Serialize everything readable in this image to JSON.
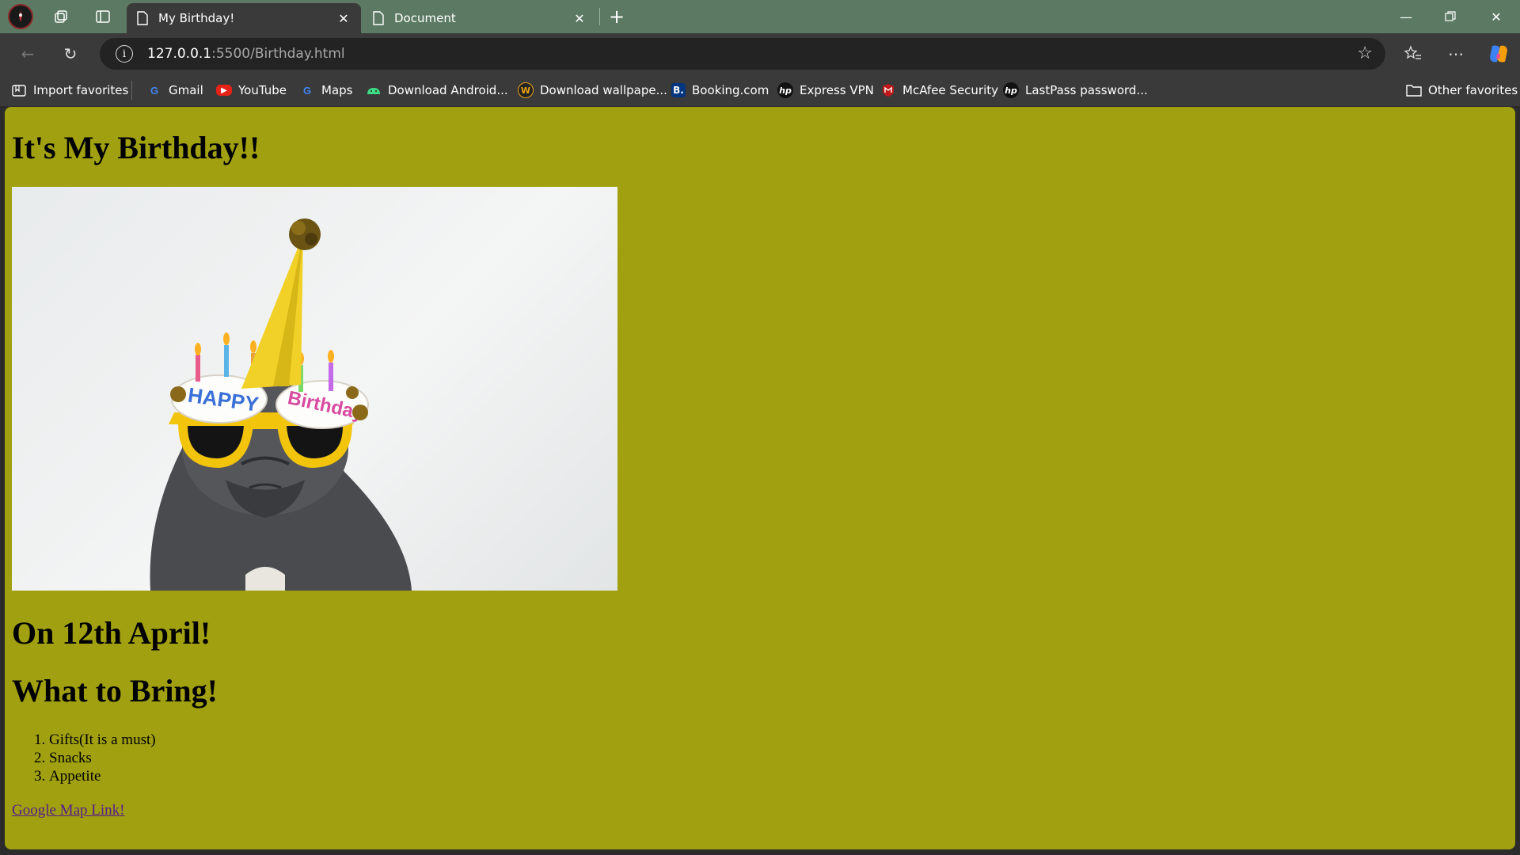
{
  "browser": {
    "tabs": [
      {
        "title": "My Birthday!",
        "active": true
      },
      {
        "title": "Document",
        "active": false
      }
    ],
    "address": {
      "host": "127.0.0.1",
      "rest": ":5500/Birthday.html"
    },
    "bookmarks": [
      {
        "label": "Import favorites",
        "icon": "import-icon"
      },
      {
        "label": "Gmail",
        "icon": "google-icon"
      },
      {
        "label": "YouTube",
        "icon": "youtube-icon"
      },
      {
        "label": "Maps",
        "icon": "google-icon"
      },
      {
        "label": "Download Android...",
        "icon": "android-icon"
      },
      {
        "label": "Download wallpape...",
        "icon": "wallpaper-icon"
      },
      {
        "label": "Booking.com",
        "icon": "booking-icon"
      },
      {
        "label": "Express VPN",
        "icon": "hp-icon"
      },
      {
        "label": "McAfee Security",
        "icon": "mcafee-icon"
      },
      {
        "label": "LastPass password...",
        "icon": "hp-icon"
      }
    ],
    "other_favorites": "Other favorites",
    "colors": {
      "tabstrip": "#5c7a63",
      "toolbar": "#3a3a3a",
      "page_bg": "#a0a010"
    }
  },
  "page": {
    "heading": "It's My Birthday!!",
    "image": {
      "subject": "pug-party-hat-photo",
      "hat_text": "HAPPY Birthday"
    },
    "date_heading": "On 12th April!",
    "bring_heading": "What to Bring!",
    "bring_items": [
      "Gifts(It is a must)",
      "Snacks",
      "Appetite"
    ],
    "map_link": "Google Map Link!"
  }
}
